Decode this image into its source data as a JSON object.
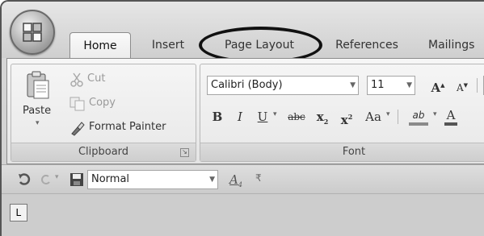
{
  "tabs": [
    {
      "label": "Home",
      "active": true
    },
    {
      "label": "Insert"
    },
    {
      "label": "Page Layout",
      "highlighted": true
    },
    {
      "label": "References"
    },
    {
      "label": "Mailings"
    }
  ],
  "clipboard": {
    "paste_label": "Paste",
    "cut_label": "Cut",
    "copy_label": "Copy",
    "format_painter_label": "Format Painter",
    "group_label": "Clipboard"
  },
  "font": {
    "font_name": "Calibri (Body)",
    "font_size": "11",
    "grow_font": "A",
    "shrink_font": "A",
    "bold": "B",
    "italic": "I",
    "underline": "U",
    "strikethrough": "abc",
    "subscript": "x",
    "superscript": "x",
    "change_case": "Aa",
    "highlight": "ab",
    "font_color": "A",
    "group_label": "Font"
  },
  "qat": {
    "style_value": "Normal",
    "style_preview": "A"
  },
  "ruler": {
    "tab_selector": "L"
  },
  "colors": {
    "circle": "#111111",
    "ribbon_bg": "#ececec",
    "font_color_bar": "#555555",
    "highlight_bar": "#8a8a8a"
  }
}
